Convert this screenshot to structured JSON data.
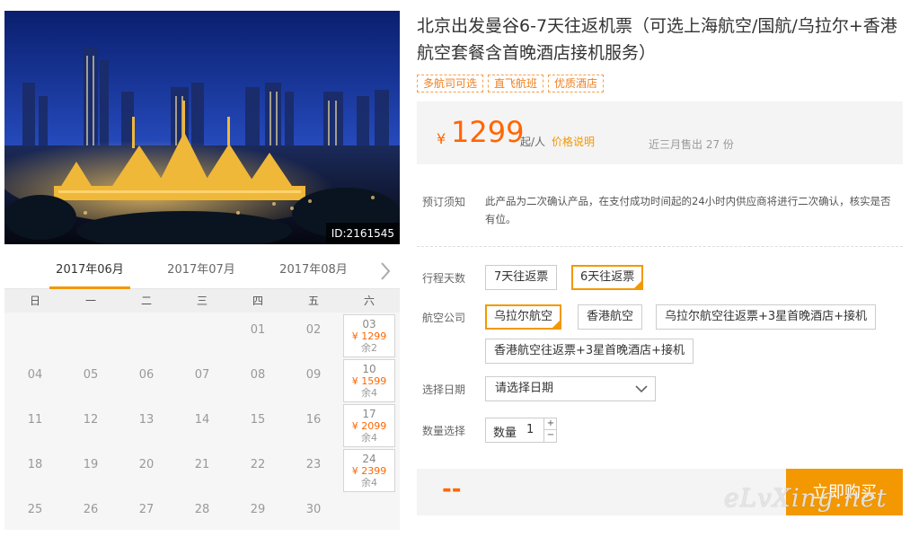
{
  "hero": {
    "id_badge": "ID:2161545"
  },
  "calendar": {
    "months": [
      "2017年06月",
      "2017年07月",
      "2017年08月"
    ],
    "active_month": "2017年06月",
    "weekdays": [
      "日",
      "一",
      "二",
      "三",
      "四",
      "五",
      "六"
    ],
    "rows": [
      [
        {
          "d": ""
        },
        {
          "d": ""
        },
        {
          "d": ""
        },
        {
          "d": ""
        },
        {
          "d": "01"
        },
        {
          "d": "02"
        },
        {
          "d": "03",
          "price": "¥ 1299",
          "stock": "余2"
        }
      ],
      [
        {
          "d": "04"
        },
        {
          "d": "05"
        },
        {
          "d": "06"
        },
        {
          "d": "07"
        },
        {
          "d": "08"
        },
        {
          "d": "09"
        },
        {
          "d": "10",
          "price": "¥ 1599",
          "stock": "余4"
        }
      ],
      [
        {
          "d": "11"
        },
        {
          "d": "12"
        },
        {
          "d": "13"
        },
        {
          "d": "14"
        },
        {
          "d": "15"
        },
        {
          "d": "16"
        },
        {
          "d": "17",
          "price": "¥ 2099",
          "stock": "余4"
        }
      ],
      [
        {
          "d": "18"
        },
        {
          "d": "19"
        },
        {
          "d": "20"
        },
        {
          "d": "21"
        },
        {
          "d": "22"
        },
        {
          "d": "23"
        },
        {
          "d": "24",
          "price": "¥ 2399",
          "stock": "余4"
        }
      ],
      [
        {
          "d": "25"
        },
        {
          "d": "26"
        },
        {
          "d": "27"
        },
        {
          "d": "28"
        },
        {
          "d": "29"
        },
        {
          "d": "30"
        },
        {
          "d": ""
        }
      ]
    ]
  },
  "product": {
    "title": "北京出发曼谷6-7天往返机票（可选上海航空/国航/乌拉尔+香港航空套餐含首晚酒店接机服务）",
    "tags": [
      "多航司可选",
      "直飞航班",
      "优质酒店"
    ],
    "price": {
      "currency": "¥",
      "amount": "1299",
      "per": "起/人",
      "note_link": "价格说明",
      "sold": "近三月售出 27 份"
    },
    "notice": {
      "label": "预订须知",
      "text": "此产品为二次确认产品，在支付成功时间起的24小时内供应商将进行二次确认，核实是否有位。"
    },
    "days": {
      "label": "行程天数",
      "options": [
        "7天往返票",
        "6天往返票"
      ],
      "selected": "6天往返票"
    },
    "airline": {
      "label": "航空公司",
      "options": [
        "乌拉尔航空",
        "香港航空",
        "乌拉尔航空往返票+3星首晚酒店+接机",
        "香港航空往返票+3星首晚酒店+接机"
      ],
      "selected": "乌拉尔航空"
    },
    "date": {
      "label": "选择日期",
      "placeholder": "请选择日期"
    },
    "quantity": {
      "label": "数量选择",
      "field_label": "数量",
      "value": "1",
      "plus": "+",
      "minus": "−"
    },
    "total": "--",
    "buy_label": "立即购买"
  },
  "watermark": "eLvXing.net",
  "colors": {
    "accent": "#f39800",
    "price": "#ff6600"
  }
}
